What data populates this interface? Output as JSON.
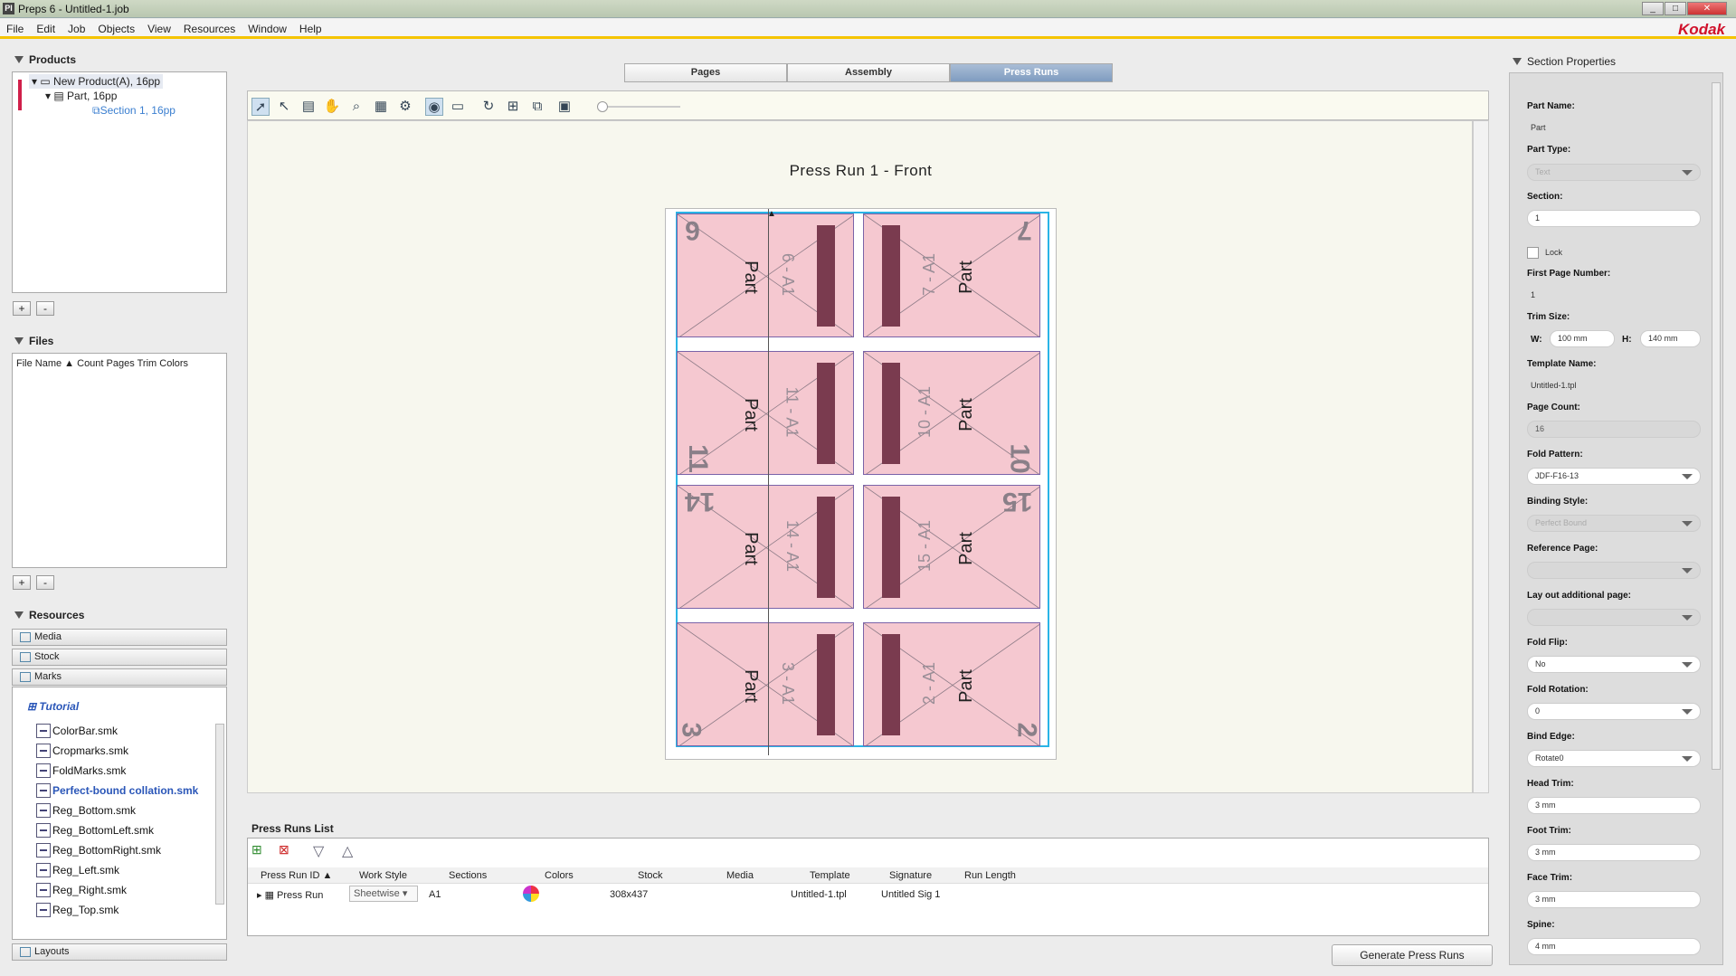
{
  "window": {
    "title": "Preps 6 - Untitled-1.job",
    "brand": "Kodak"
  },
  "menu": [
    "File",
    "Edit",
    "Job",
    "Objects",
    "View",
    "Resources",
    "Window",
    "Help"
  ],
  "products": {
    "header": "Products",
    "tree": [
      "New Product(A), 16pp",
      "Part, 16pp",
      "Section 1, 16pp"
    ],
    "add": "+",
    "remove": "-"
  },
  "files": {
    "header": "Files",
    "columns": [
      "File Name",
      "Count",
      "Pages",
      "Trim",
      "Colors"
    ],
    "add": "+",
    "remove": "-"
  },
  "resources": {
    "header": "Resources",
    "categories": [
      "Media",
      "Stock",
      "Marks"
    ],
    "group": "Tutorial",
    "files": [
      "ColorBar.smk",
      "Cropmarks.smk",
      "FoldMarks.smk",
      "Perfect-bound collation.smk",
      "Reg_Bottom.smk",
      "Reg_BottomLeft.smk",
      "Reg_BottomRight.smk",
      "Reg_Left.smk",
      "Reg_Right.smk",
      "Reg_Top.smk"
    ],
    "selected": "Perfect-bound collation.smk",
    "layouts": "Layouts"
  },
  "tabs": [
    "Pages",
    "Assembly",
    "Press Runs"
  ],
  "active_tab": "Press Runs",
  "canvas": {
    "title": "Press Run 1 - Front",
    "pages": [
      {
        "no": "6",
        "label": "Part",
        "code": "6 - A1"
      },
      {
        "no": "7",
        "label": "Part",
        "code": "7 - A1"
      },
      {
        "no": "11",
        "label": "Part",
        "code": "11 - A1"
      },
      {
        "no": "10",
        "label": "Part",
        "code": "10 - A1"
      },
      {
        "no": "14",
        "label": "Part",
        "code": "14 - A1"
      },
      {
        "no": "15",
        "label": "Part",
        "code": "15 - A1"
      },
      {
        "no": "3",
        "label": "Part",
        "code": "3 - A1"
      },
      {
        "no": "2",
        "label": "Part",
        "code": "2 - A1"
      }
    ],
    "colors": {
      "page_fill": "#f5c8d0",
      "page_border": "#7a63a8",
      "spine_bar": "#7a3b4f",
      "sheet_outline": "#2ab4e6"
    }
  },
  "press_runs": {
    "header": "Press Runs List",
    "columns": [
      "Press Run ID",
      "Work Style",
      "Sections",
      "Colors",
      "Stock",
      "Media",
      "Template",
      "Signature",
      "Run Length"
    ],
    "row": {
      "id": "Press Run",
      "work_style": "Sheetwise",
      "sections": "A1",
      "stock": "308x437",
      "media": "",
      "template": "Untitled-1.tpl",
      "signature": "Untitled Sig 1",
      "run_length": ""
    },
    "generate": "Generate Press Runs"
  },
  "section_properties": {
    "header": "Section Properties",
    "part_name_label": "Part Name:",
    "part_name": "Part",
    "part_type_label": "Part Type:",
    "part_type": "Text",
    "section_label": "Section:",
    "section": "1",
    "lock": "Lock",
    "first_page_label": "First Page Number:",
    "first_page": "1",
    "trim_size_label": "Trim Size:",
    "w_label": "W:",
    "w": "100 mm",
    "h_label": "H:",
    "h": "140 mm",
    "template_name_label": "Template Name:",
    "template_name": "Untitled-1.tpl",
    "page_count_label": "Page Count:",
    "page_count": "16",
    "fold_pattern_label": "Fold Pattern:",
    "fold_pattern": "JDF-F16-13",
    "binding_style_label": "Binding Style:",
    "binding_style": "Perfect Bound",
    "reference_page_label": "Reference Page:",
    "layout_additional_label": "Lay out additional page:",
    "fold_flip_label": "Fold Flip:",
    "fold_flip": "No",
    "fold_rotation_label": "Fold Rotation:",
    "fold_rotation": "0",
    "bind_edge_label": "Bind Edge:",
    "bind_edge": "Rotate0",
    "head_trim_label": "Head Trim:",
    "head_trim": "3 mm",
    "foot_trim_label": "Foot Trim:",
    "foot_trim": "3 mm",
    "face_trim_label": "Face Trim:",
    "face_trim": "3 mm",
    "spine_label": "Spine:",
    "spine": "4 mm"
  }
}
